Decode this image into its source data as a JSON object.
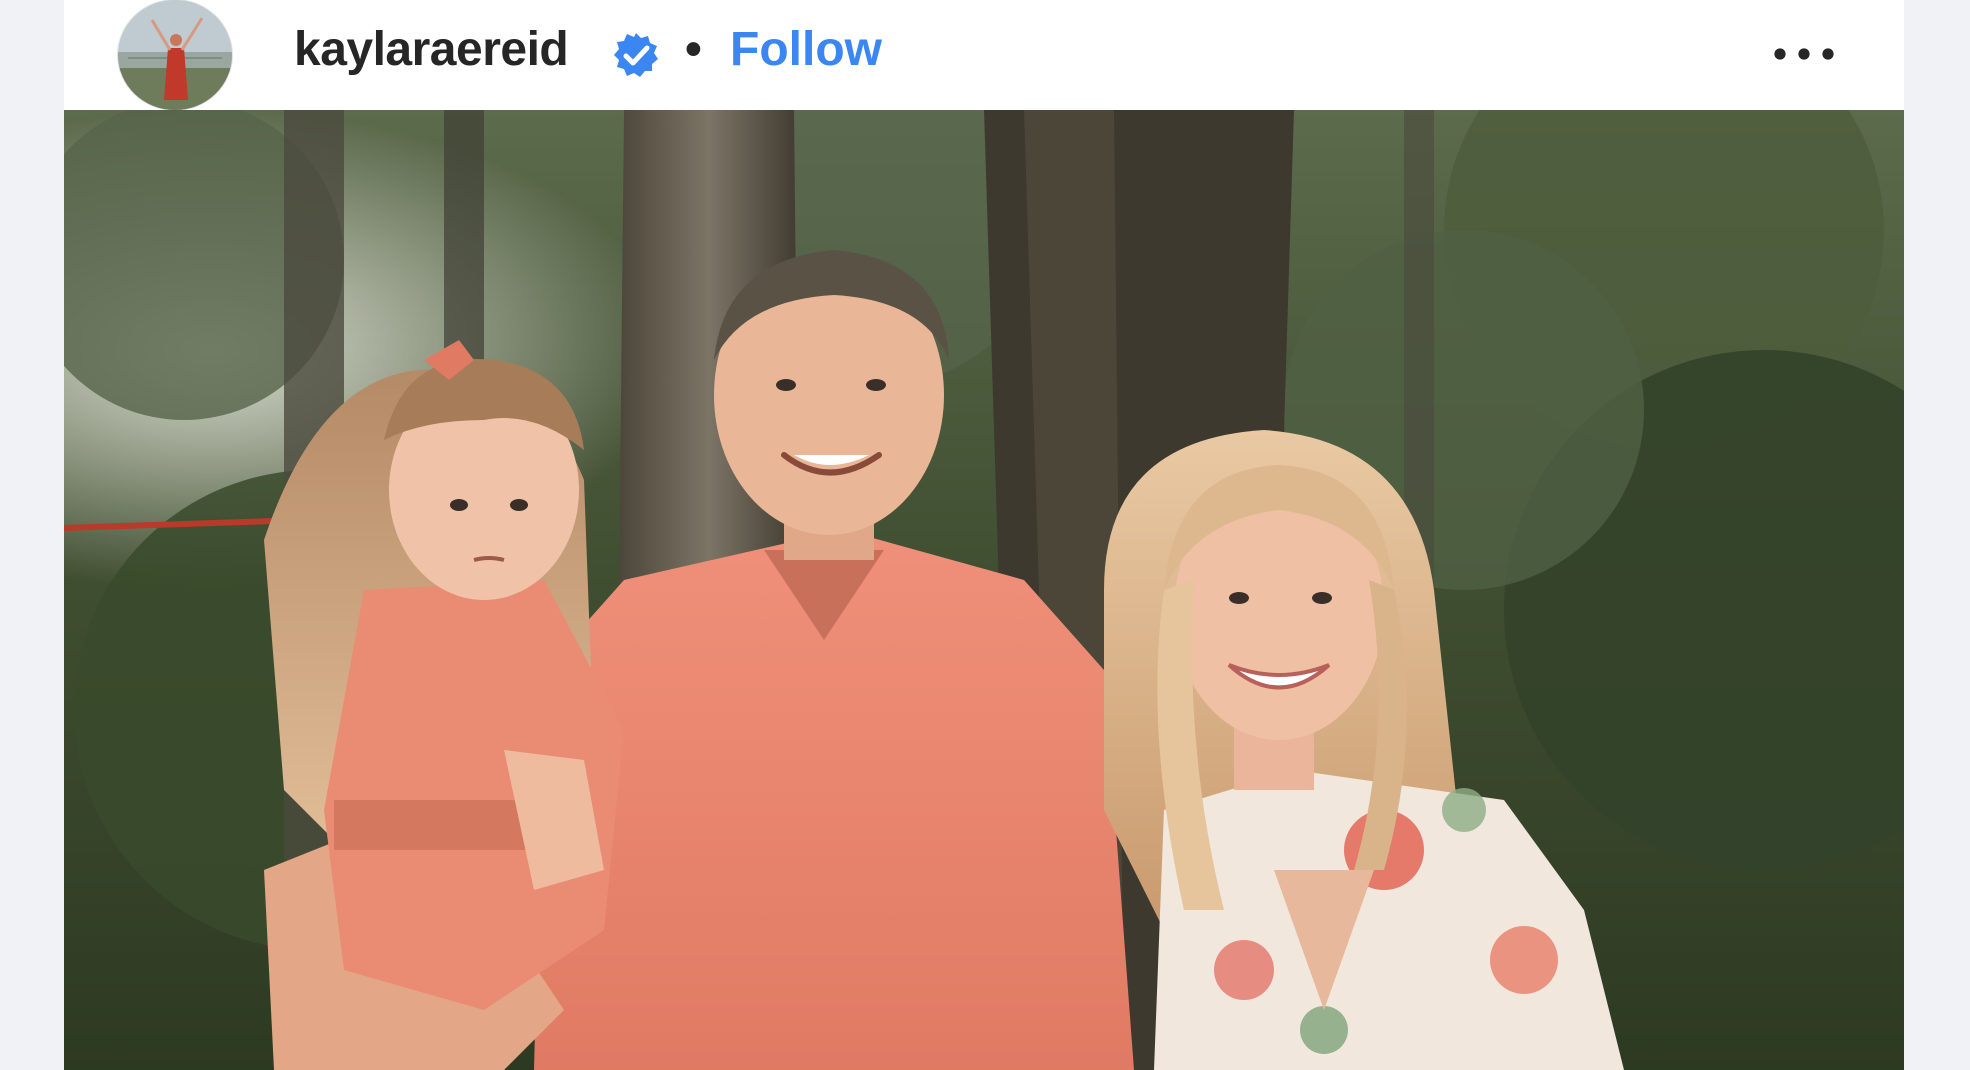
{
  "post": {
    "username": "kaylaraereid",
    "verified_icon": "verified-badge-icon",
    "separator": "•",
    "follow_label": "Follow",
    "more_icon": "more-options-icon"
  },
  "colors": {
    "follow_blue": "#3b86f0",
    "verified_blue": "#3b86f0",
    "username_text": "#262626"
  },
  "photo": {
    "subject": "family-photo"
  }
}
